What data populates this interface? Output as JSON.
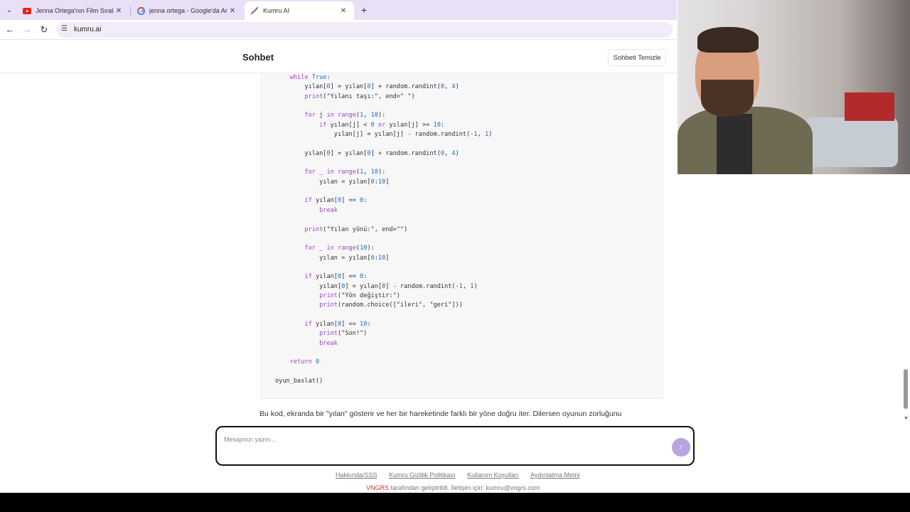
{
  "browser": {
    "tabs": [
      {
        "label": "Jenna Ortega'nın Film Sıralama",
        "icon": "youtube-icon",
        "active": false
      },
      {
        "label": "jenna ortega - Google'da Ara",
        "icon": "google-icon",
        "active": false
      },
      {
        "label": "Kumru AI",
        "icon": "kumru-icon",
        "active": true
      }
    ],
    "url": "kumru.ai"
  },
  "header": {
    "title": "Sohbet",
    "clear_label": "Sohbeti Temizle"
  },
  "message_text": "Bu kod, ekranda bir \"yılan\" gösterir ve her bir hareketinde farklı bir yöne doğru iter. Dilersen oyunun zorluğunu",
  "composer": {
    "placeholder": "Mesajınızı yazın..."
  },
  "footer": {
    "links": [
      "Hakkında/SSS",
      "Kumru Gizlilik Politikası",
      "Kullanım Koşulları",
      "Aydınlatma Metni"
    ],
    "brand": "VNGRS",
    "credit_rest": " tarafından geliştirildi. İletişim için: kumru@vngrs.com"
  },
  "colors": {
    "tab_strip": "#e9dff7",
    "send_button": "#b8a4df",
    "keyword": "#a13ed1",
    "number": "#1a6cc4",
    "brand": "#c7362f"
  }
}
